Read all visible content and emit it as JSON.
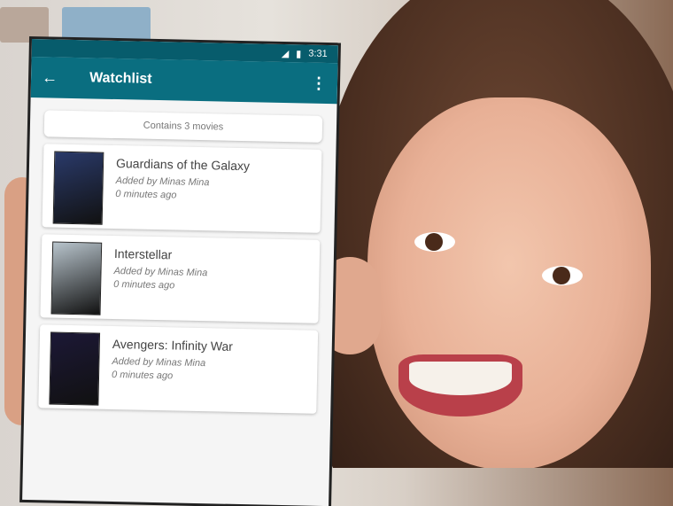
{
  "status_bar": {
    "time": "3:31",
    "signal_icon": "signal-icon",
    "battery_icon": "battery-icon"
  },
  "toolbar": {
    "title": "Watchlist",
    "back_icon": "←",
    "menu_icon": "⋮"
  },
  "summary": "Contains 3 movies",
  "movies": [
    {
      "title": "Guardians of the Galaxy",
      "added_by": "Added by Minas Mina",
      "time": "0 minutes ago",
      "poster_color": "#2a3a6a"
    },
    {
      "title": "Interstellar",
      "added_by": "Added by Minas Mina",
      "time": "0 minutes ago",
      "poster_color": "#b8c4cc"
    },
    {
      "title": "Avengers: Infinity War",
      "added_by": "Added by Minas Mina",
      "time": "0 minutes ago",
      "poster_color": "#1c1836"
    }
  ]
}
